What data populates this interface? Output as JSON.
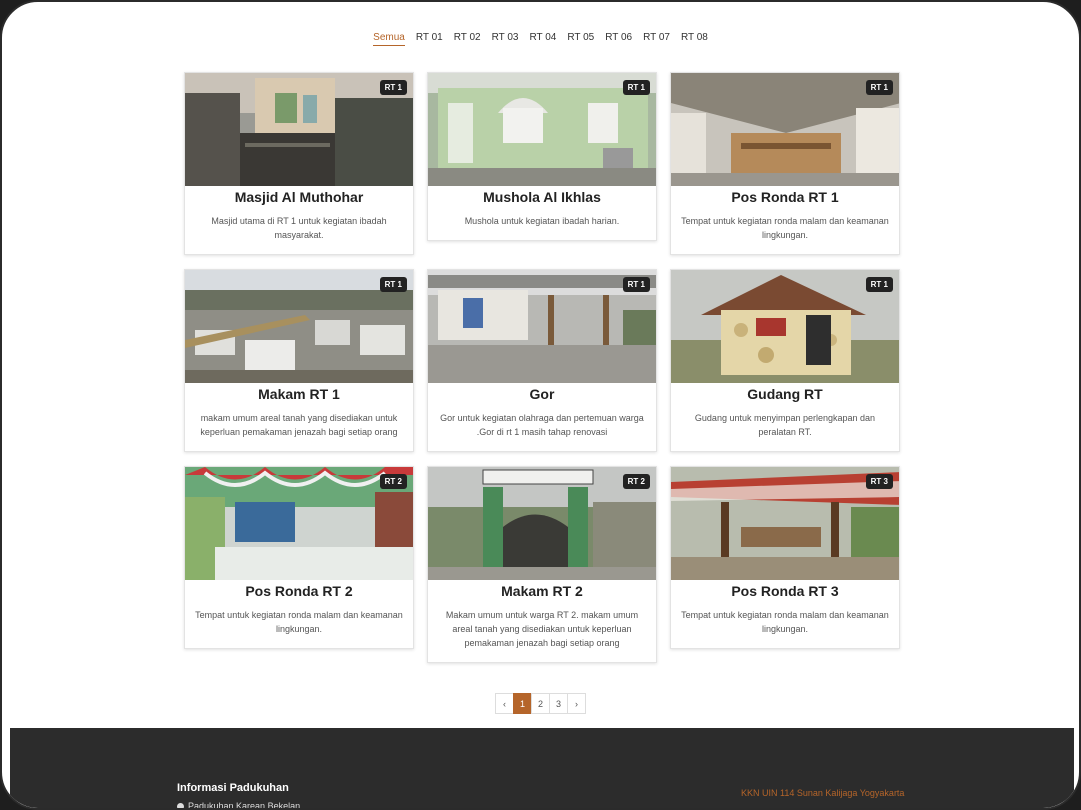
{
  "filters": [
    "Semua",
    "RT 01",
    "RT 02",
    "RT 03",
    "RT 04",
    "RT 05",
    "RT 06",
    "RT 07",
    "RT 08"
  ],
  "cards": [
    {
      "badge": "RT 1",
      "title": "Masjid Al Muthohar",
      "desc": "Masjid utama di RT 1 untuk kegiatan ibadah masyarakat."
    },
    {
      "badge": "RT 1",
      "title": "Mushola Al Ikhlas",
      "desc": "Mushola untuk kegiatan ibadah harian."
    },
    {
      "badge": "RT 1",
      "title": "Pos Ronda RT 1",
      "desc": "Tempat untuk kegiatan ronda malam dan keamanan lingkungan."
    },
    {
      "badge": "RT 1",
      "title": "Makam RT 1",
      "desc": "makam umum areal tanah yang disediakan untuk keperluan pemakaman jenazah bagi setiap orang"
    },
    {
      "badge": "RT 1",
      "title": "Gor",
      "desc": "Gor untuk kegiatan olahraga dan pertemuan warga .Gor di rt 1 masih tahap renovasi"
    },
    {
      "badge": "RT 1",
      "title": "Gudang RT",
      "desc": "Gudang untuk menyimpan perlengkapan dan peralatan RT."
    },
    {
      "badge": "RT 2",
      "title": "Pos Ronda RT 2",
      "desc": "Tempat untuk kegiatan ronda malam dan keamanan lingkungan."
    },
    {
      "badge": "RT 2",
      "title": "Makam RT 2",
      "desc": "Makam umum untuk warga RT 2. makam umum areal tanah yang disediakan untuk keperluan pemakaman jenazah bagi setiap orang"
    },
    {
      "badge": "RT 3",
      "title": "Pos Ronda RT 3",
      "desc": "Tempat untuk kegiatan ronda malam dan keamanan lingkungan."
    }
  ],
  "pagination": {
    "prev": "‹",
    "pages": [
      "1",
      "2",
      "3"
    ],
    "next": "›"
  },
  "footer": {
    "title": "Informasi Padukuhan",
    "address": "Padukuhan Karean Bekelan",
    "credit": "KKN UIN 114 Sunan Kalijaga Yogyakarta"
  }
}
